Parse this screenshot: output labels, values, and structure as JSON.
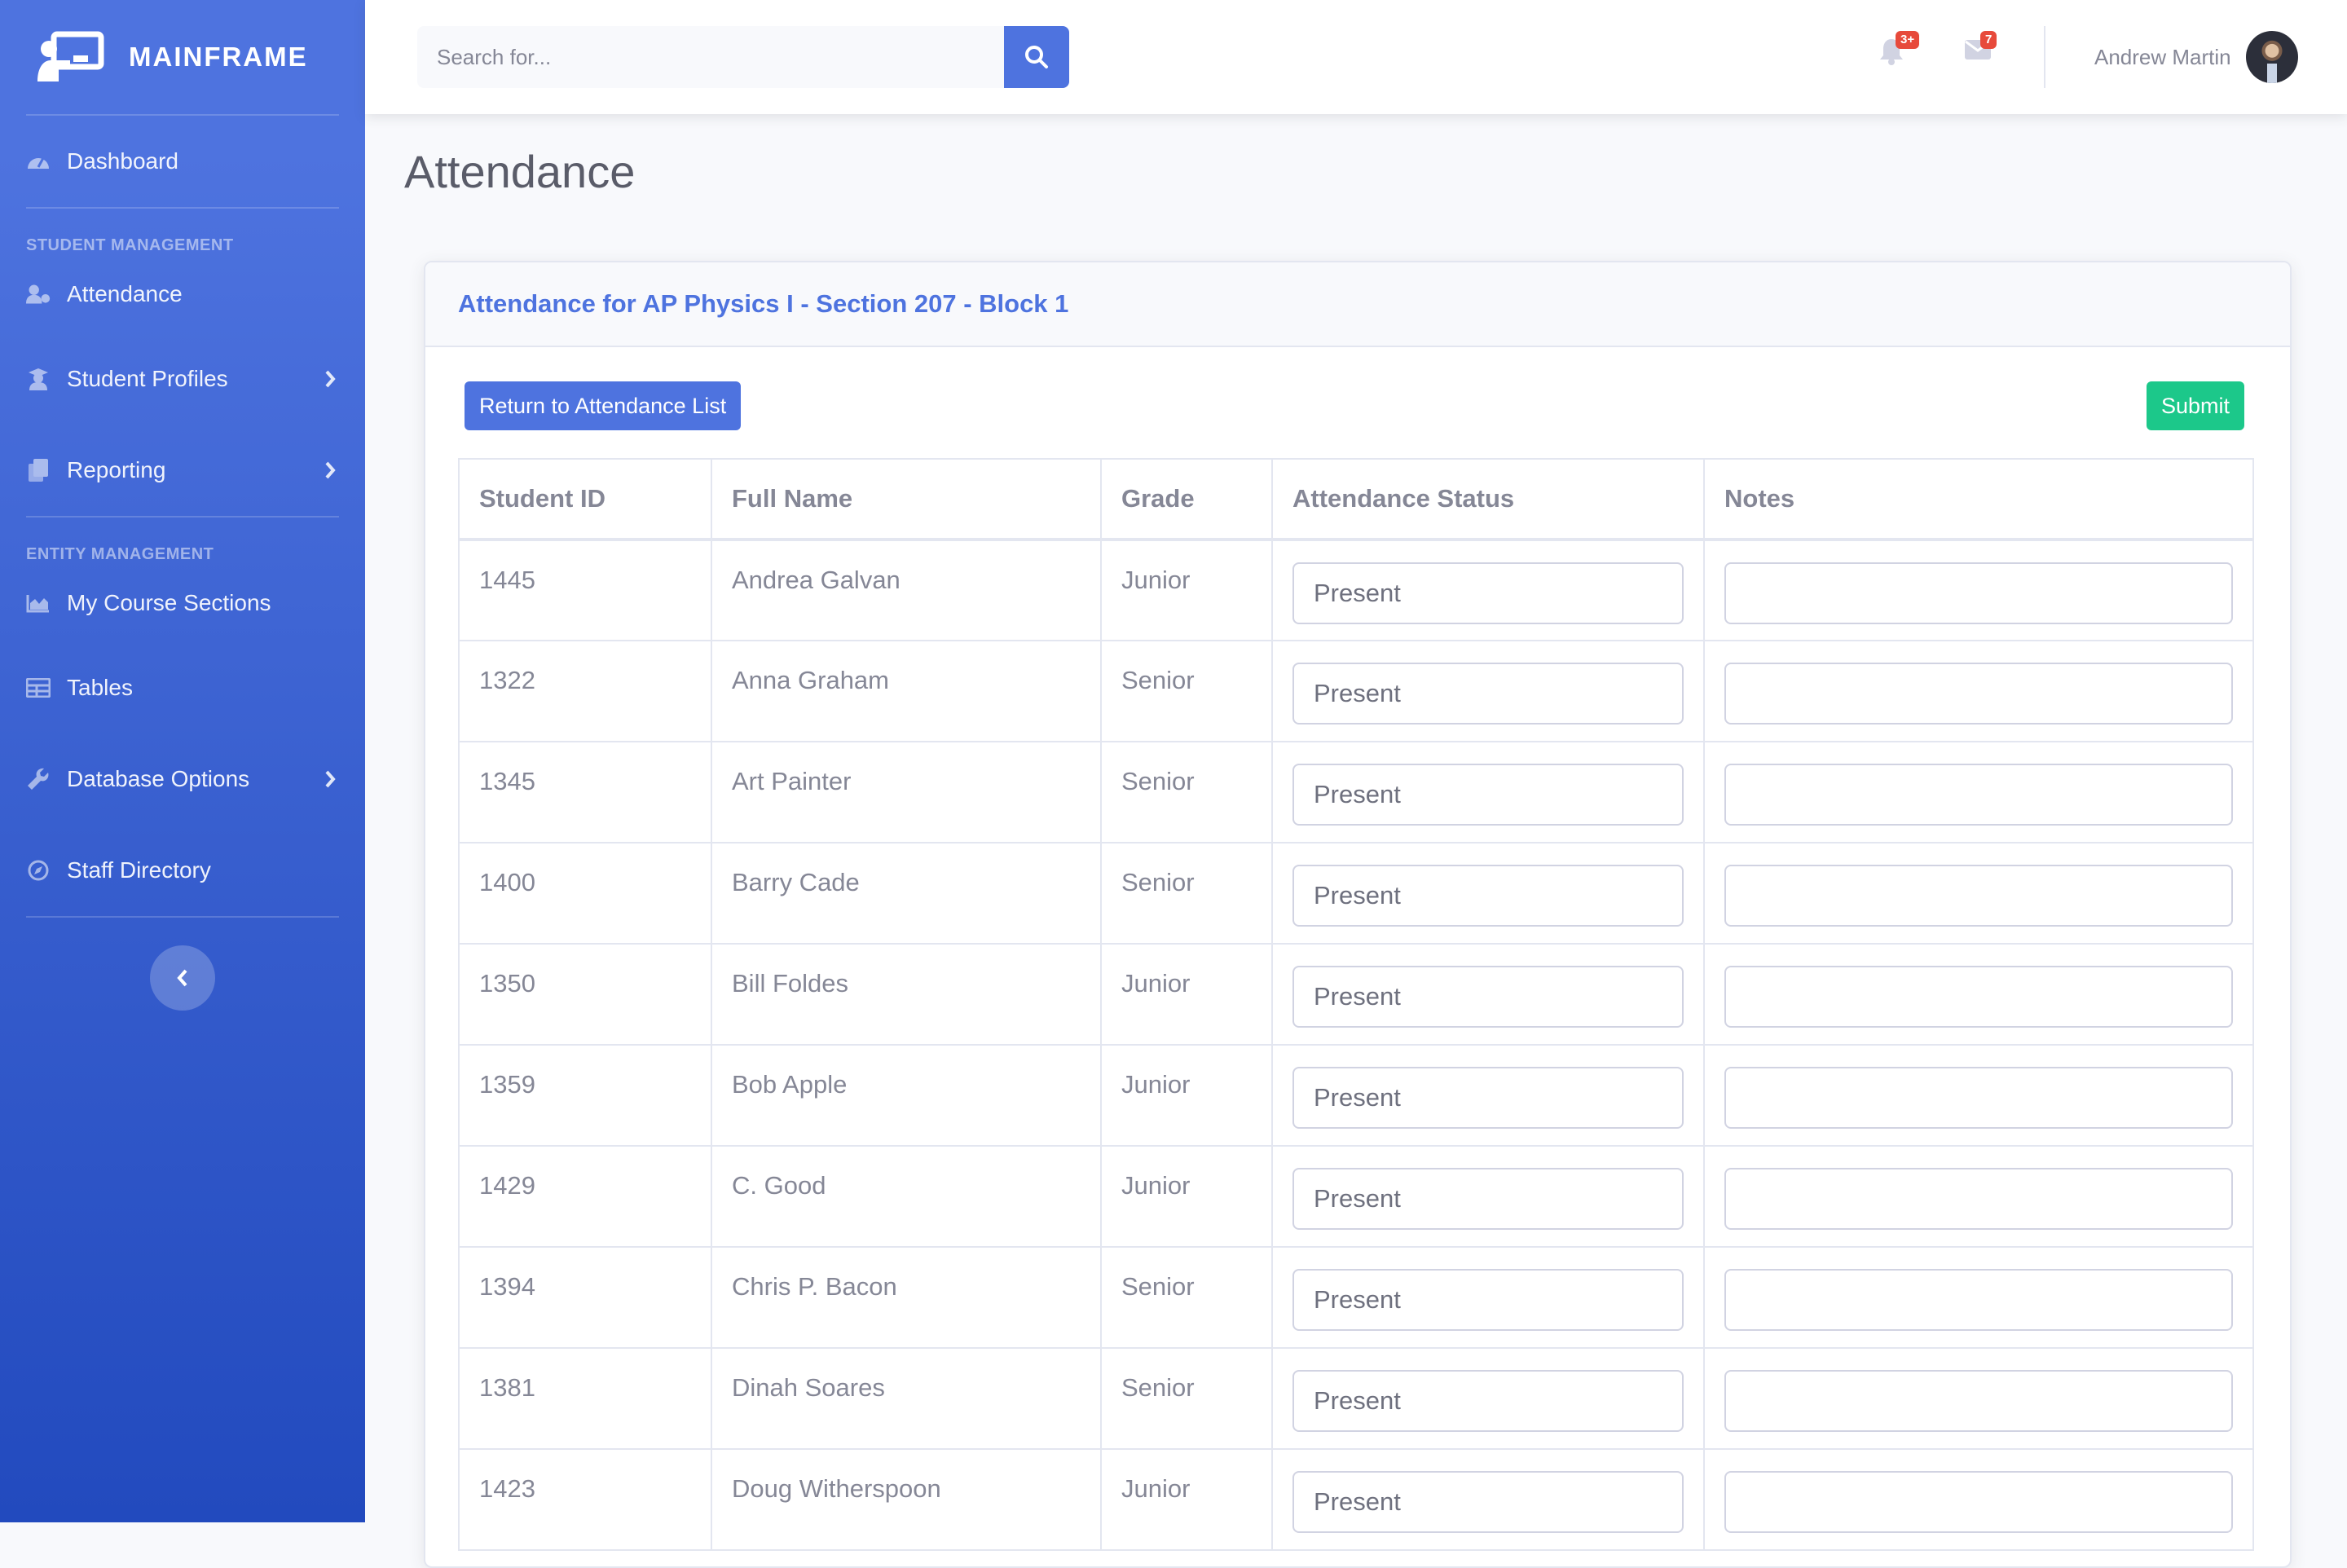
{
  "brand": {
    "name": "MAINFRAME"
  },
  "sidebar": {
    "dashboard": "Dashboard",
    "heading_students": "STUDENT MANAGEMENT",
    "attendance": "Attendance",
    "student_profiles": "Student Profiles",
    "reporting": "Reporting",
    "heading_entities": "ENTITY MANAGEMENT",
    "my_course_sections": "My Course Sections",
    "tables": "Tables",
    "database_options": "Database Options",
    "staff_directory": "Staff Directory"
  },
  "topbar": {
    "search_placeholder": "Search for...",
    "alerts_badge": "3+",
    "messages_badge": "7",
    "user_name": "Andrew Martin"
  },
  "page": {
    "title": "Attendance",
    "card_title": "Attendance for AP Physics I - Section 207 - Block 1",
    "return_button": "Return to Attendance List",
    "submit_button": "Submit"
  },
  "table": {
    "headers": [
      "Student ID",
      "Full Name",
      "Grade",
      "Attendance Status",
      "Notes"
    ],
    "rows": [
      {
        "id": "1445",
        "name": "Andrea Galvan",
        "grade": "Junior",
        "status": "Present",
        "notes": ""
      },
      {
        "id": "1322",
        "name": "Anna Graham",
        "grade": "Senior",
        "status": "Present",
        "notes": ""
      },
      {
        "id": "1345",
        "name": "Art Painter",
        "grade": "Senior",
        "status": "Present",
        "notes": ""
      },
      {
        "id": "1400",
        "name": "Barry Cade",
        "grade": "Senior",
        "status": "Present",
        "notes": ""
      },
      {
        "id": "1350",
        "name": "Bill Foldes",
        "grade": "Junior",
        "status": "Present",
        "notes": ""
      },
      {
        "id": "1359",
        "name": "Bob Apple",
        "grade": "Junior",
        "status": "Present",
        "notes": ""
      },
      {
        "id": "1429",
        "name": "C. Good",
        "grade": "Junior",
        "status": "Present",
        "notes": ""
      },
      {
        "id": "1394",
        "name": "Chris P. Bacon",
        "grade": "Senior",
        "status": "Present",
        "notes": ""
      },
      {
        "id": "1381",
        "name": "Dinah Soares",
        "grade": "Senior",
        "status": "Present",
        "notes": ""
      },
      {
        "id": "1423",
        "name": "Doug Witherspoon",
        "grade": "Junior",
        "status": "Present",
        "notes": ""
      }
    ]
  },
  "colors": {
    "primary": "#4e73df",
    "success": "#1cc88a",
    "danger": "#e74a3b",
    "text": "#858796"
  }
}
